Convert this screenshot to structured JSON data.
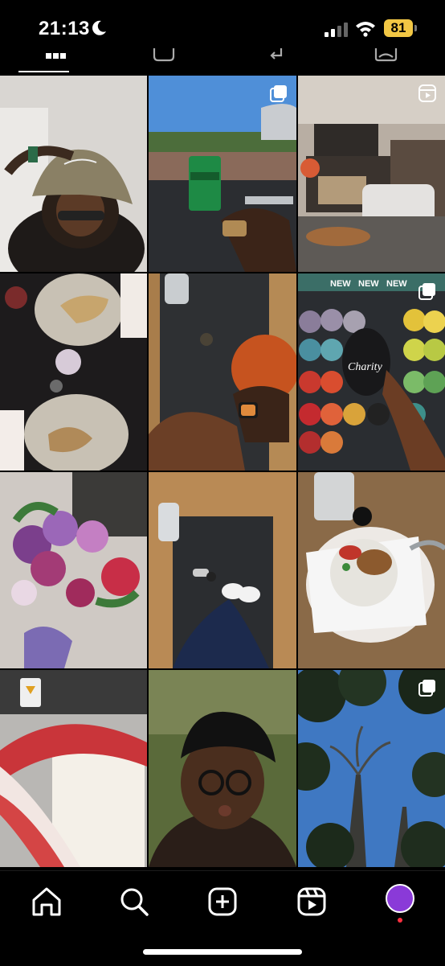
{
  "status_bar": {
    "time": "21:13",
    "battery": "81",
    "battery_color": "#f2c744"
  },
  "tabs": {
    "items": [
      {
        "icon": "grid-icon",
        "active": true
      },
      {
        "icon": "reels-icon",
        "active": false
      },
      {
        "icon": "reposts-icon",
        "active": false
      },
      {
        "icon": "tagged-icon",
        "active": false
      }
    ]
  },
  "grid": {
    "posts": [
      {
        "subject": "selfie-bucket-hat",
        "multi": false,
        "reel": false
      },
      {
        "subject": "stadium-heineken-cup",
        "multi": true,
        "reel": false
      },
      {
        "subject": "cafe-interior",
        "multi": false,
        "reel": true
      },
      {
        "subject": "dinner-plates",
        "multi": false,
        "reel": false
      },
      {
        "subject": "yoga-mat-ball",
        "multi": false,
        "reel": false
      },
      {
        "subject": "yarn-shelf",
        "multi": true,
        "reel": false,
        "text": "Charity",
        "labels": [
          "NEW",
          "NEW",
          "NEW"
        ]
      },
      {
        "subject": "flower-bouquet",
        "multi": false,
        "reel": false
      },
      {
        "subject": "yoga-mat-feet",
        "multi": false,
        "reel": false
      },
      {
        "subject": "yogurt-granola",
        "multi": false,
        "reel": false
      },
      {
        "subject": "crochet-project",
        "multi": false,
        "reel": false
      },
      {
        "subject": "selfie-headwrap",
        "multi": false,
        "reel": false
      },
      {
        "subject": "forest-sky",
        "multi": true,
        "reel": false
      }
    ]
  },
  "bottom_nav": {
    "items": [
      {
        "icon": "home-icon"
      },
      {
        "icon": "search-icon"
      },
      {
        "icon": "create-post-icon"
      },
      {
        "icon": "reels-icon"
      },
      {
        "icon": "profile-avatar"
      }
    ],
    "avatar_color": "#8a3ad8",
    "notification_color": "#ff3040"
  }
}
